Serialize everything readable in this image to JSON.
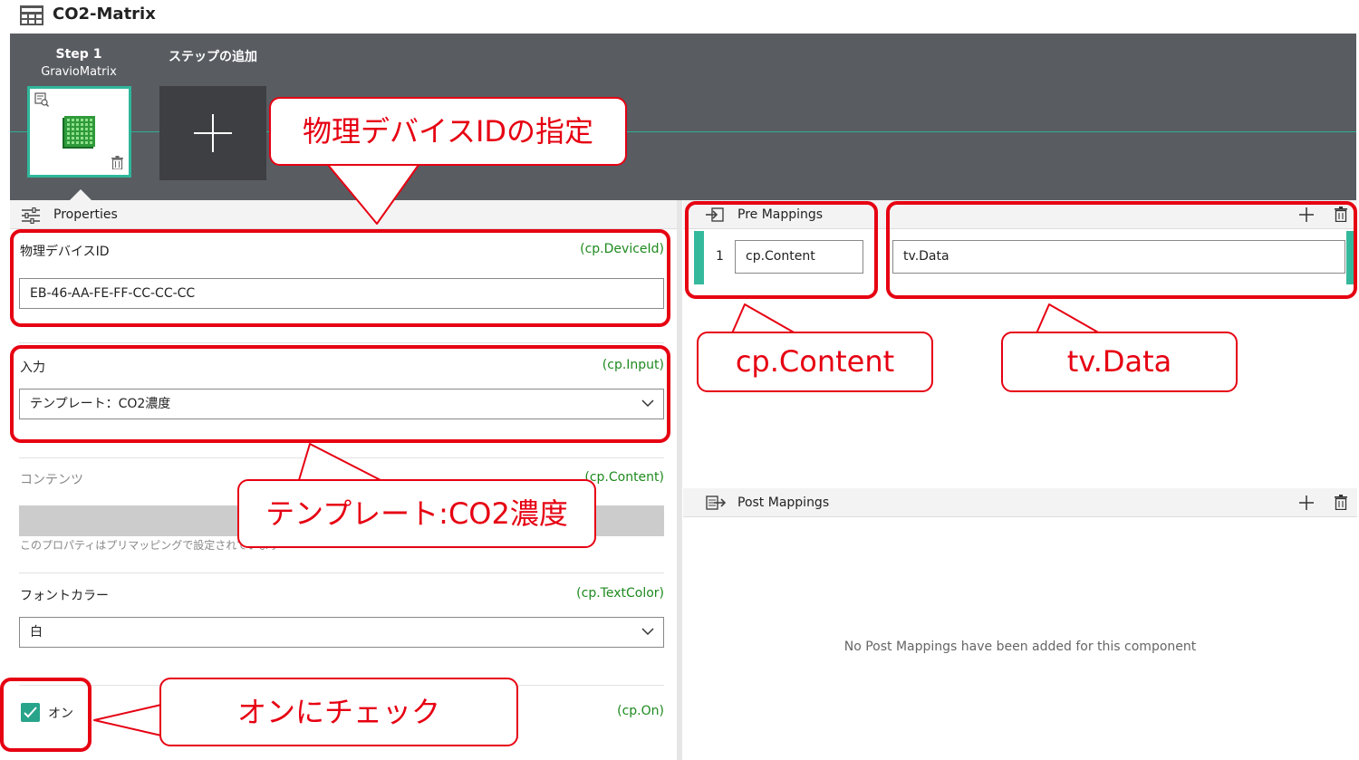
{
  "app": {
    "title": "CO2-Matrix"
  },
  "steps": {
    "step1_label": "Step 1",
    "step1_name": "GravioMatrix",
    "add_label": "ステップの追加"
  },
  "properties": {
    "header": "Properties",
    "device_id": {
      "label": "物理デバイスID",
      "code": "(cp.DeviceId)",
      "value": "EB-46-AA-FE-FF-CC-CC-CC"
    },
    "input": {
      "label": "入力",
      "code": "(cp.Input)",
      "selected": "テンプレート：CO2濃度"
    },
    "content": {
      "label": "コンテンツ",
      "code": "(cp.Content)",
      "note": "このプロパティはプリマッピングで設定されています"
    },
    "font_color": {
      "label": "フォントカラー",
      "code": "(cp.TextColor)",
      "selected": "白"
    },
    "on": {
      "label": "オン",
      "code": "(cp.On)",
      "checked": true
    }
  },
  "pre_mappings": {
    "header": "Pre Mappings",
    "rows": [
      {
        "index": "1",
        "target": "cp.Content",
        "source": "tv.Data"
      }
    ]
  },
  "post_mappings": {
    "header": "Post Mappings",
    "empty_message": "No Post Mappings have been added for this component"
  },
  "annotations": {
    "device_id_callout": "物理デバイスIDの指定",
    "content_callout": "cp.Content",
    "data_callout": "tv.Data",
    "template_callout": "テンプレート:CO2濃度",
    "check_callout": "オンにチェック"
  },
  "colors": {
    "accent": "#2fb79b",
    "annotation": "#e60012",
    "code_text": "#1e8a1e",
    "step_strip": "#595c61"
  },
  "icons": [
    "app-grid-icon",
    "matrix-component-icon",
    "plus-icon",
    "trash-icon",
    "sliders-icon",
    "import-icon",
    "export-icon",
    "chevron-down-icon",
    "check-icon"
  ]
}
